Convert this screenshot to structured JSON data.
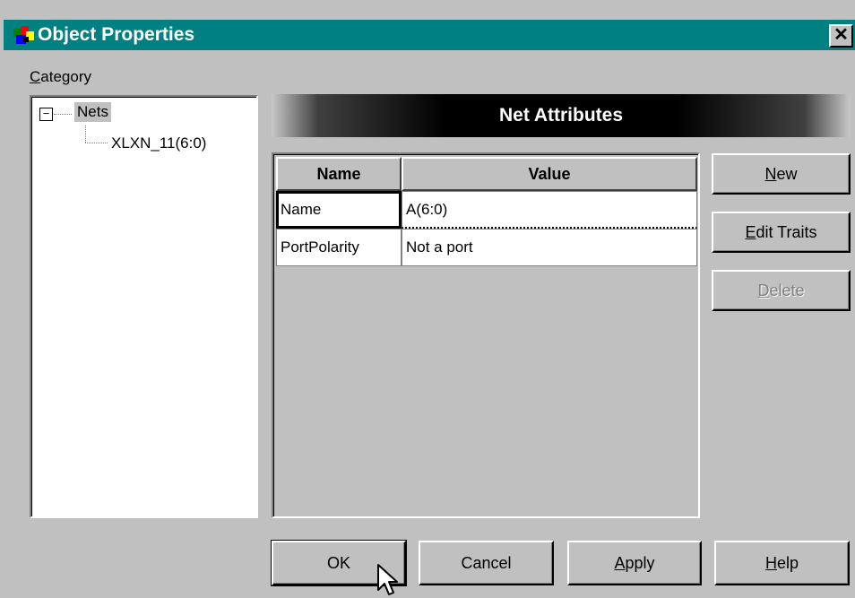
{
  "window": {
    "title": "Object Properties",
    "close_glyph": "✕"
  },
  "category": {
    "label_accel": "C",
    "label_rest": "ategory",
    "tree": {
      "expander": "−",
      "root": "Nets",
      "child": "XLXN_11(6:0)"
    }
  },
  "panel": {
    "header": "Net Attributes",
    "columns": [
      "Name",
      "Value"
    ],
    "rows": [
      {
        "name": "Name",
        "value": "A(6:0)"
      },
      {
        "name": "PortPolarity",
        "value": "Not a port"
      }
    ]
  },
  "side_buttons": {
    "new": {
      "accel": "N",
      "rest": "ew"
    },
    "edit_traits": {
      "accel": "E",
      "rest": "dit Traits"
    },
    "delete": {
      "accel": "D",
      "rest": "elete"
    }
  },
  "footer_buttons": {
    "ok": "OK",
    "cancel": "Cancel",
    "apply": {
      "accel": "A",
      "rest": "pply"
    },
    "help": {
      "accel": "H",
      "rest": "elp"
    }
  },
  "colors": {
    "titlebar": "#008080",
    "face": "#c0c0c0"
  },
  "icons": {
    "app": "app-properties-icon",
    "close": "close-icon",
    "cursor": "mouse-pointer-icon"
  }
}
